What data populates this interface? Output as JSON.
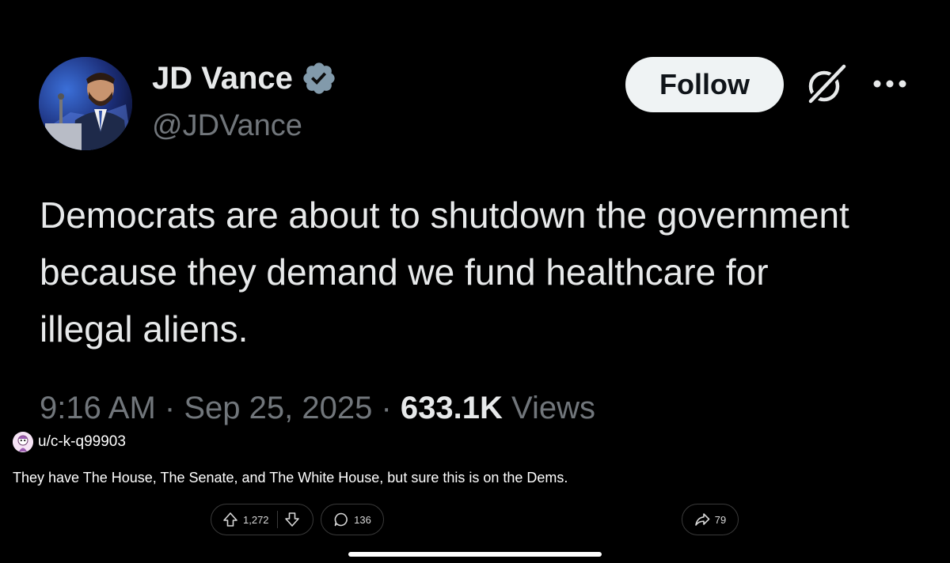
{
  "tweet": {
    "author_name": "JD Vance",
    "handle": "@JDVance",
    "follow_label": "Follow",
    "text": "Democrats are about to shutdown the government because they demand we fund healthcare for illegal aliens.",
    "time": "9:16 AM",
    "date": "Sep 25, 2025",
    "views_count": "633.1K",
    "views_label": "Views",
    "separator": "·",
    "verified_color": "#829aab",
    "icons": [
      "verified-badge-icon",
      "grok-icon",
      "more-options-icon"
    ]
  },
  "comment": {
    "username": "u/c-k-q99903",
    "body": "They have The House, The Senate, and The White House, but sure this is on the Dems.",
    "upvotes": "1,272",
    "replies": "136",
    "shares": "79",
    "icons": [
      "upvote-icon",
      "downvote-icon",
      "comment-bubble-icon",
      "share-arrow-icon"
    ]
  }
}
